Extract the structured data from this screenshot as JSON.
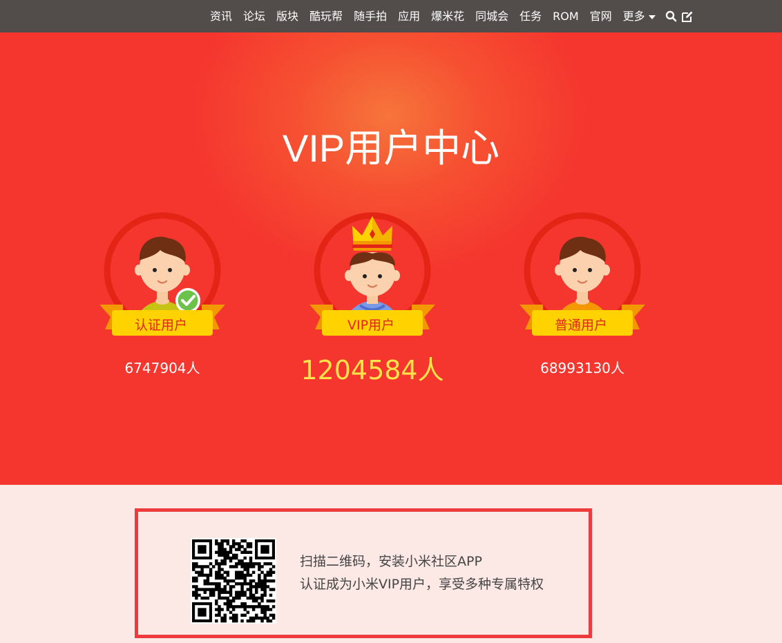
{
  "nav": {
    "items": [
      "资讯",
      "论坛",
      "版块",
      "酷玩帮",
      "随手拍",
      "应用",
      "爆米花",
      "同城会",
      "任务",
      "ROM",
      "官网"
    ],
    "more_label": "更多",
    "search_icon": "search-icon",
    "compose_icon": "edit-icon"
  },
  "hero": {
    "title": "VIP用户中心",
    "cards": [
      {
        "label": "认证用户",
        "count": "6747904人",
        "shirt_color": "#c7c313",
        "badge": "check-badge-icon"
      },
      {
        "label": "VIP用户",
        "count": "1204584人",
        "shirt_color": "#7b9ae6",
        "badge": "crown-icon"
      },
      {
        "label": "普通用户",
        "count": "68993130人",
        "shirt_color": "#f39800"
      }
    ]
  },
  "promo": {
    "line1": "扫描二维码，安装小米社区APP",
    "line2": "认证成为小米VIP用户，享受多种专属特权",
    "qr_icon": "qr-code-icon"
  },
  "colors": {
    "topbar": "#524d4b",
    "hero_bg": "#f5362f",
    "ring": "#e42414",
    "ribbon": "#ffd200",
    "promo_border": "#ee3b3e"
  }
}
